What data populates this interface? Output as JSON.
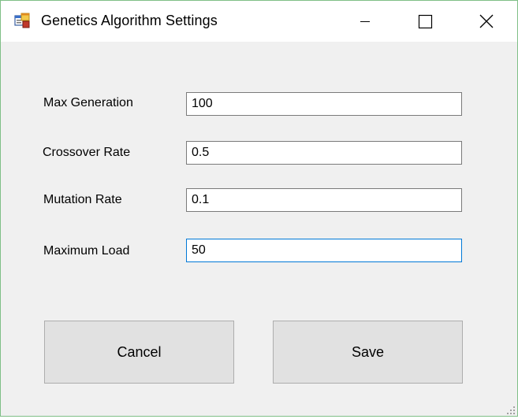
{
  "window": {
    "title": "Genetics Algorithm Settings",
    "app_icon": "app-form-icon",
    "controls": {
      "minimize_icon": "minimize-icon",
      "maximize_icon": "maximize-icon",
      "close_icon": "close-icon"
    }
  },
  "form": {
    "fields": [
      {
        "label": "Max Generation",
        "value": "100"
      },
      {
        "label": "Crossover Rate",
        "value": "0.5"
      },
      {
        "label": "Mutation Rate",
        "value": "0.1"
      },
      {
        "label": "Maximum Load",
        "value": "50"
      }
    ]
  },
  "buttons": {
    "cancel_label": "Cancel",
    "save_label": "Save"
  },
  "colors": {
    "window_border": "#7fbf87",
    "background": "#f0f0f0",
    "focus_border": "#0078d7",
    "button_bg": "#e1e1e1"
  }
}
